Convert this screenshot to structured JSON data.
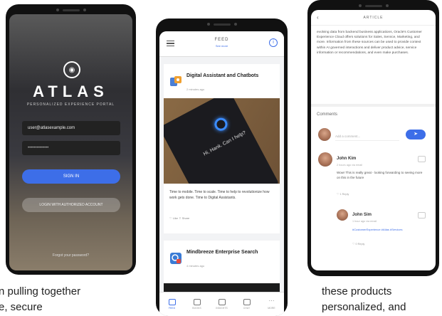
{
  "login_screen": {
    "brand": "ATLAS",
    "logo_icon": "eye-logo-icon",
    "tagline": "PERSONALIZED EXPERIENCE PORTAL",
    "email_value": "user@atlasexample.com",
    "password_placeholder": "••••••••••••••",
    "sign_in_label": "SIGN IN",
    "secondary_label": "LOGIN WITH AUTHORIZED ACCOUNT",
    "footer": "Forgot your password?"
  },
  "feed_screen": {
    "title": "FEED",
    "subtitle": "See more",
    "menu_icon": "hamburger-menu-icon",
    "info_icon": "info-icon",
    "card1": {
      "title": "Digital Assistant and Chatbots",
      "meta": "2 minutes ago",
      "image_text": "Hi, Hank. Can I help?",
      "body": "Time to mobile. Time to scale. Time to help to revolutionize how work gets done. Time to Digital Assistants.",
      "actions": "♡  Like    ⇪  Share"
    },
    "card2": {
      "title": "Mindbreeze Enterprise Search",
      "meta": "4 minutes ago"
    },
    "tabs": [
      {
        "label": "FEED",
        "icon": "feed-icon",
        "active": true
      },
      {
        "label": "BOOKS",
        "icon": "books-icon",
        "active": false
      },
      {
        "label": "INSIGHTS",
        "icon": "insights-icon",
        "active": false
      },
      {
        "label": "CHAT",
        "icon": "chat-icon",
        "active": false
      },
      {
        "label": "MORE",
        "icon": "more-icon",
        "active": false
      }
    ]
  },
  "article_screen": {
    "header_title": "ARTICLE",
    "back_icon": "back-arrow-icon",
    "body": "evolving data from backend business applications, Oracle's Customer Experience Cloud offers solutions for Sales, Service, Marketing, and more. Information from these sources can be used to provide context within AI governed interactions and deliver product advice, service information or recommendations, and even make purchases.",
    "comments_label": "Comments",
    "compose_placeholder": "Add a comment...",
    "send_icon": "send-icon",
    "comment1": {
      "name": "John Kim",
      "meta": "2 hours ago via email",
      "text": "Wow! This is really great - looking forwarding to seeing more on this in the future",
      "actions": "♡ 1    Reply"
    },
    "comment2": {
      "name": "John Sim",
      "meta": "1 hour ago via email",
      "tags": "#CustomerExperience #Atlas    #Services",
      "actions": "♡ 0    Reply"
    }
  },
  "captions": {
    "left": "n pulling together",
    "left_line2": "e, secure",
    "right": "these products",
    "right_line2": "personalized, and"
  },
  "colors": {
    "accent": "#3d6ee8",
    "phone_frame": "#111111"
  }
}
